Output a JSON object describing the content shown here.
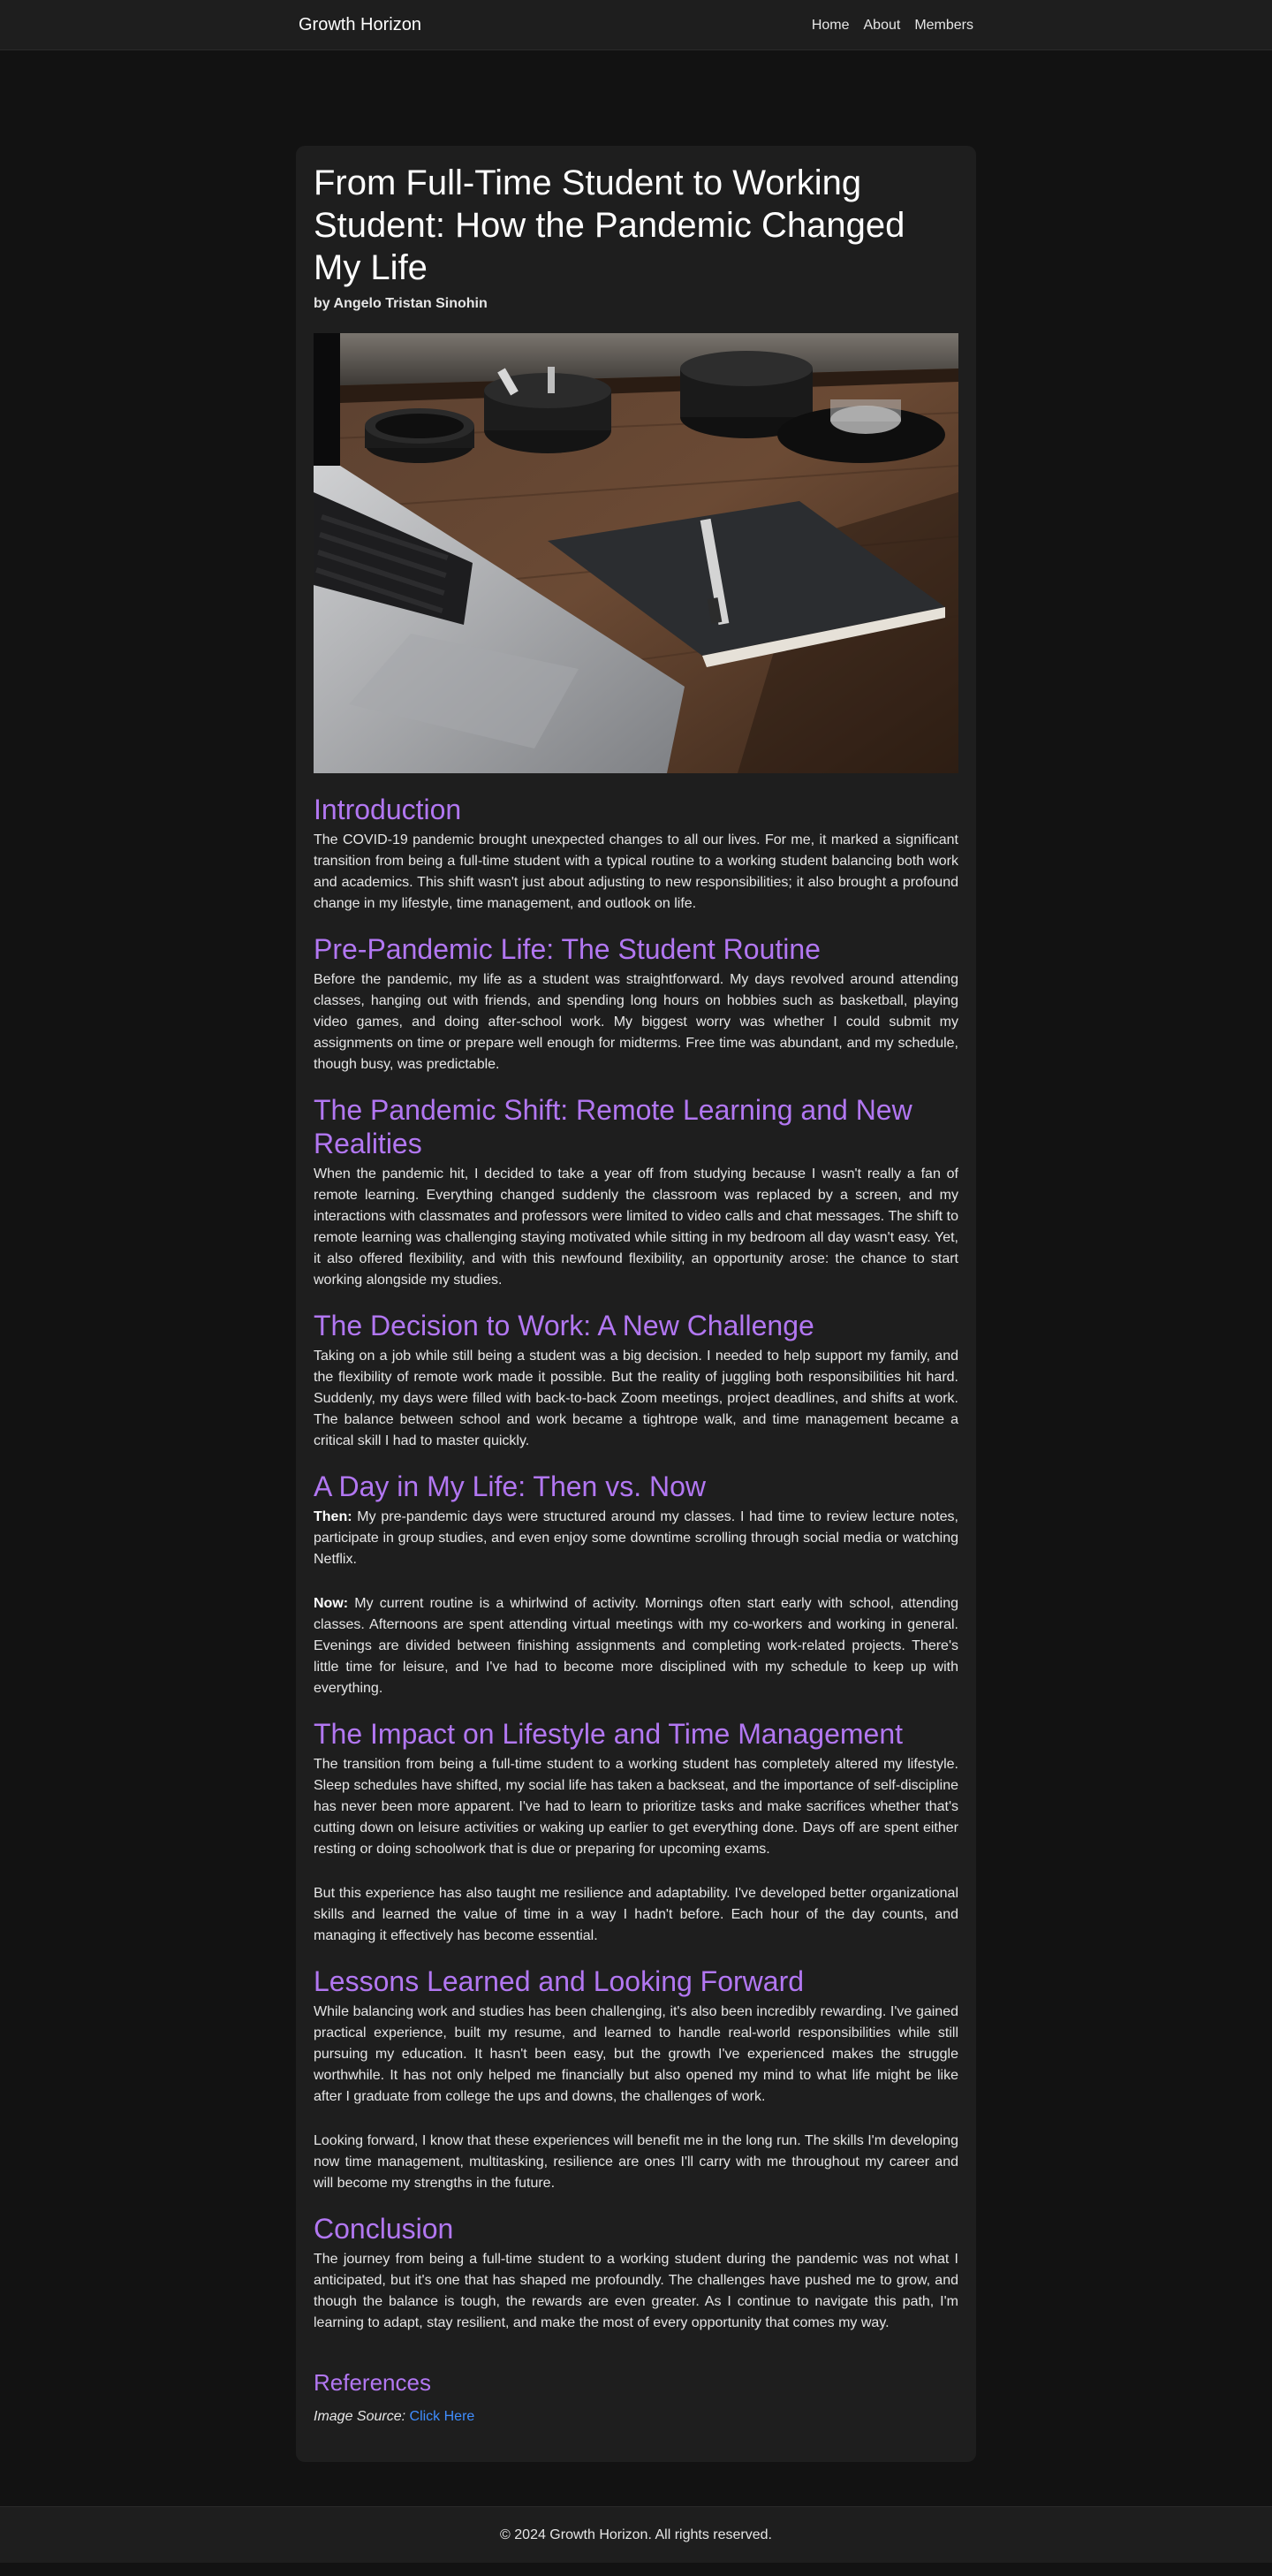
{
  "nav": {
    "brand": "Growth Horizon",
    "links": [
      "Home",
      "About",
      "Members"
    ]
  },
  "article": {
    "title": "From Full-Time Student to Working Student: How the Pandemic Changed My Life",
    "byline": "by Angelo Tristan Sinohin",
    "sections": [
      {
        "heading": "Introduction",
        "paragraphs": [
          "The COVID-19 pandemic brought unexpected changes to all our lives. For me, it marked a significant transition from being a full-time student with a typical routine to a working student balancing both work and academics. This shift wasn't just about adjusting to new responsibilities; it also brought a profound change in my lifestyle, time management, and outlook on life."
        ]
      },
      {
        "heading": "Pre-Pandemic Life: The Student Routine",
        "paragraphs": [
          "Before the pandemic, my life as a student was straightforward. My days revolved around attending classes, hanging out with friends, and spending long hours on hobbies such as basketball, playing video games, and doing after-school work. My biggest worry was whether I could submit my assignments on time or prepare well enough for midterms. Free time was abundant, and my schedule, though busy, was predictable."
        ]
      },
      {
        "heading": "The Pandemic Shift: Remote Learning and New Realities",
        "paragraphs": [
          "When the pandemic hit, I decided to take a year off from studying because I wasn't really a fan of remote learning. Everything changed suddenly the classroom was replaced by a screen, and my interactions with classmates and professors were limited to video calls and chat messages. The shift to remote learning was challenging staying motivated while sitting in my bedroom all day wasn't easy. Yet, it also offered flexibility, and with this newfound flexibility, an opportunity arose: the chance to start working alongside my studies."
        ]
      },
      {
        "heading": "The Decision to Work: A New Challenge",
        "paragraphs": [
          "Taking on a job while still being a student was a big decision. I needed to help support my family, and the flexibility of remote work made it possible. But the reality of juggling both responsibilities hit hard. Suddenly, my days were filled with back-to-back Zoom meetings, project deadlines, and shifts at work. The balance between school and work became a tightrope walk, and time management became a critical skill I had to master quickly."
        ]
      },
      {
        "heading": "A Day in My Life: Then vs. Now",
        "labeled": [
          {
            "label": "Then:",
            "text": " My pre-pandemic days were structured around my classes. I had time to review lecture notes, participate in group studies, and even enjoy some downtime scrolling through social media or watching Netflix."
          },
          {
            "label": "Now:",
            "text": " My current routine is a whirlwind of activity. Mornings often start early with school, attending classes. Afternoons are spent attending virtual meetings with my co-workers and working in general. Evenings are divided between finishing assignments and completing work-related projects. There's little time for leisure, and I've had to become more disciplined with my schedule to keep up with everything."
          }
        ]
      },
      {
        "heading": "The Impact on Lifestyle and Time Management",
        "paragraphs": [
          "The transition from being a full-time student to a working student has completely altered my lifestyle. Sleep schedules have shifted, my social life has taken a backseat, and the importance of self-discipline has never been more apparent. I've had to learn to prioritize tasks and make sacrifices whether that's cutting down on leisure activities or waking up earlier to get everything done. Days off are spent either resting or doing schoolwork that is due or preparing for upcoming exams.",
          "But this experience has also taught me resilience and adaptability. I've developed better organizational skills and learned the value of time in a way I hadn't before. Each hour of the day counts, and managing it effectively has become essential."
        ]
      },
      {
        "heading": "Lessons Learned and Looking Forward",
        "paragraphs": [
          "While balancing work and studies has been challenging, it's also been incredibly rewarding. I've gained practical experience, built my resume, and learned to handle real-world responsibilities while still pursuing my education. It hasn't been easy, but the growth I've experienced makes the struggle worthwhile. It has not only helped me financially but also opened my mind to what life might be like after I graduate from college the ups and downs, the challenges of work.",
          "Looking forward, I know that these experiences will benefit me in the long run. The skills I'm developing now time management, multitasking, resilience are ones I'll carry with me throughout my career and will become my strengths in the future."
        ]
      },
      {
        "heading": "Conclusion",
        "paragraphs": [
          "The journey from being a full-time student to a working student during the pandemic was not what I anticipated, but it's one that has shaped me profoundly. The challenges have pushed me to grow, and though the balance is tough, the rewards are even greater. As I continue to navigate this path, I'm learning to adapt, stay resilient, and make the most of every opportunity that comes my way."
        ]
      }
    ],
    "references": {
      "heading": "References",
      "source_label": "Image Source:",
      "link_text": "Click Here"
    }
  },
  "footer": {
    "text": "© 2024 Growth Horizon. All rights reserved."
  },
  "colors": {
    "background": "#121212",
    "card": "#1e1e1e",
    "heading_accent": "#b277f2",
    "link": "#3f8dff"
  }
}
